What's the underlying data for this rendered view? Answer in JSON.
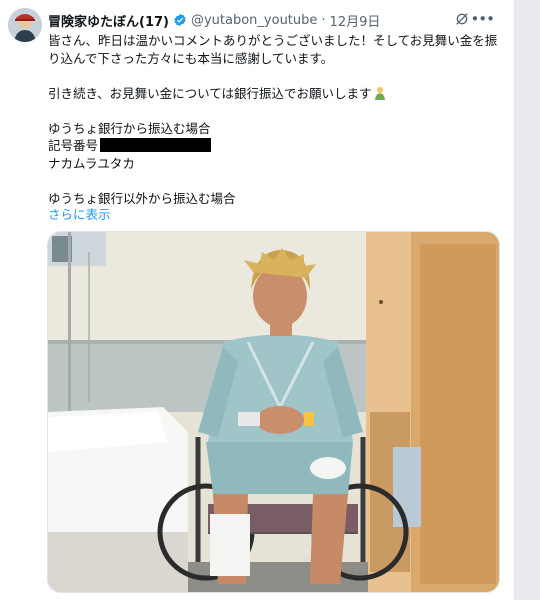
{
  "tweet": {
    "display_name": "冒険家ゆたぼん(17)",
    "handle": "@yutabon_youtube",
    "separator": "·",
    "date": "12月9日",
    "lines": [
      "皆さん、昨日は温かいコメントありがとうございました！そしてお見舞い金を振り込んで下さった方々にも本当に感謝しています。",
      "引き続き、お見舞い金については銀行振込でお願いします",
      "ゆうちょ銀行から振込む場合",
      "記号番号",
      "ナカムラユタカ",
      "ゆうちょ銀行以外から振込む場合"
    ],
    "show_more": "さらに表示"
  },
  "icons": {
    "verified": "verified-badge-icon",
    "grok": "grok-icon",
    "more": "more-icon",
    "emoji": "praying-person-emoji"
  },
  "colors": {
    "accent": "#1d9bf0",
    "text": "#0f1419",
    "muted": "#536471"
  }
}
